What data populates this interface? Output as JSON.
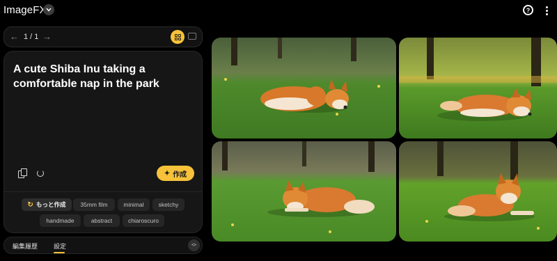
{
  "app": {
    "title": "ImageFX"
  },
  "pager": {
    "count": "1 / 1"
  },
  "prompt": {
    "text": "A cute Shiba Inu taking a comfortable nap in the park"
  },
  "actions": {
    "create_label": "作成"
  },
  "chips": {
    "more_label": "もっと作成",
    "items": [
      "35mm film",
      "minimal",
      "sketchy",
      "handmade",
      "abstract",
      "chiaroscuro"
    ]
  },
  "tabs": {
    "history": "編集履歴",
    "settings": "設定"
  },
  "icons": {
    "dropdown": "chevron-down-icon",
    "help": "help-circle-icon",
    "more": "more-vert-icon",
    "prev": "arrow-left-icon",
    "next": "arrow-right-icon",
    "grid": "grid-view-icon",
    "single": "single-view-icon",
    "copy": "copy-icon",
    "reset": "reset-icon",
    "create": "sparkle-icon",
    "expand": "unfold-icon"
  },
  "colors": {
    "accent": "#f6c23a",
    "background": "#000000",
    "card": "#161616"
  }
}
